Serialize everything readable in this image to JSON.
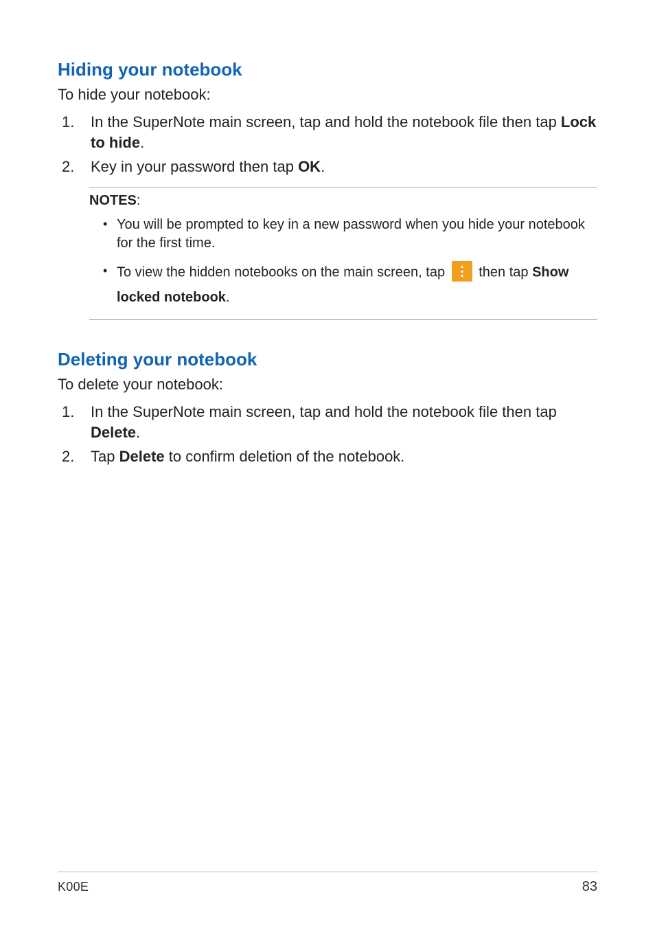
{
  "section1": {
    "heading": "Hiding your notebook",
    "intro": "To hide your notebook:",
    "steps": {
      "s1_pre": "In the SuperNote main screen, tap and hold the notebook file then tap ",
      "s1_bold": "Lock to hide",
      "s1_post": ".",
      "s2_pre": "Key in your password then tap ",
      "s2_bold": "OK",
      "s2_post": "."
    },
    "notes": {
      "label": "NOTES",
      "colon": ":",
      "n1": "You will be prompted to key in a new password when you hide your notebook for the first time.",
      "n2_pre": "To view the hidden notebooks on the main screen, tap ",
      "n2_mid": " then tap ",
      "n2_bold": "Show locked notebook",
      "n2_post": "."
    }
  },
  "section2": {
    "heading": "Deleting your notebook",
    "intro": "To delete your notebook:",
    "steps": {
      "s1_pre": "In the SuperNote main screen, tap and hold the notebook file then tap ",
      "s1_bold": "Delete",
      "s1_post": ".",
      "s2_pre": "Tap ",
      "s2_bold": "Delete",
      "s2_post": " to confirm deletion of the notebook."
    }
  },
  "footer": {
    "model": "K00E",
    "page": "83"
  }
}
